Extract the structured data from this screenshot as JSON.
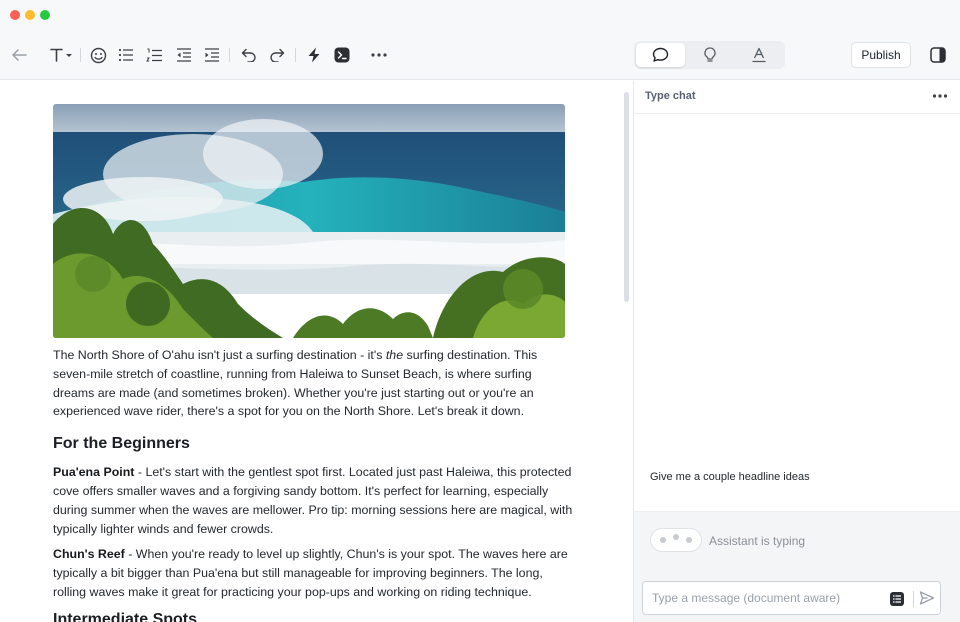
{
  "window": {
    "controls": [
      "close",
      "minimize",
      "zoom"
    ]
  },
  "toolbar": {
    "icons": [
      "back-arrow-icon",
      "text-style-icon",
      "emoji-icon",
      "bullet-list-icon",
      "numbered-list-icon",
      "outdent-icon",
      "indent-icon",
      "undo-icon",
      "redo-icon",
      "lightning-icon",
      "terminal-icon",
      "more-icon"
    ],
    "modes": [
      "chat-mode-icon",
      "ideas-mode-icon",
      "style-mode-icon"
    ],
    "active_mode": "chat",
    "publish_label": "Publish"
  },
  "article": {
    "image_alt": "Large turquoise wave breaking on the North Shore behind green foliage",
    "intro_before": "The North Shore of O'ahu isn't just a surfing destination - it's ",
    "intro_em": "the",
    "intro_after": " surfing destination. This seven-mile stretch of coastline, running from Haleiwa to Sunset Beach, is where surfing dreams are made (and sometimes broken). Whether you're just starting out or you're an experienced wave rider, there's a spot for you on the North Shore. Let's break it down.",
    "section1_heading": "For the Beginners",
    "spots": [
      {
        "name": "Pua'ena Point",
        "text": " - Let's start with the gentlest spot first. Located just past Haleiwa, this protected cove offers smaller waves and a forgiving sandy bottom. It's perfect for learning, especially during summer when the waves are mellower. Pro tip: morning sessions here are magical, with typically lighter winds and fewer crowds."
      },
      {
        "name": "Chun's Reef",
        "text": " - When you're ready to level up slightly, Chun's is your spot. The waves here are typically a bit bigger than Pua'ena but still manageable for improving beginners. The long, rolling waves make it great for practicing your pop-ups and working on riding technique."
      }
    ],
    "section2_heading": "Intermediate Spots"
  },
  "chat": {
    "title": "Type chat",
    "user_message": "Give me a couple headline ideas",
    "typing_status": "Assistant is typing",
    "input_placeholder": "Type a message (document aware)",
    "input_value": ""
  },
  "colors": {
    "window_close": "#ff5f57",
    "window_minimize": "#febc2e",
    "window_zoom": "#28c840",
    "toolbar_bg": "#f7f8fa",
    "chat_header_text": "#5a6070"
  }
}
